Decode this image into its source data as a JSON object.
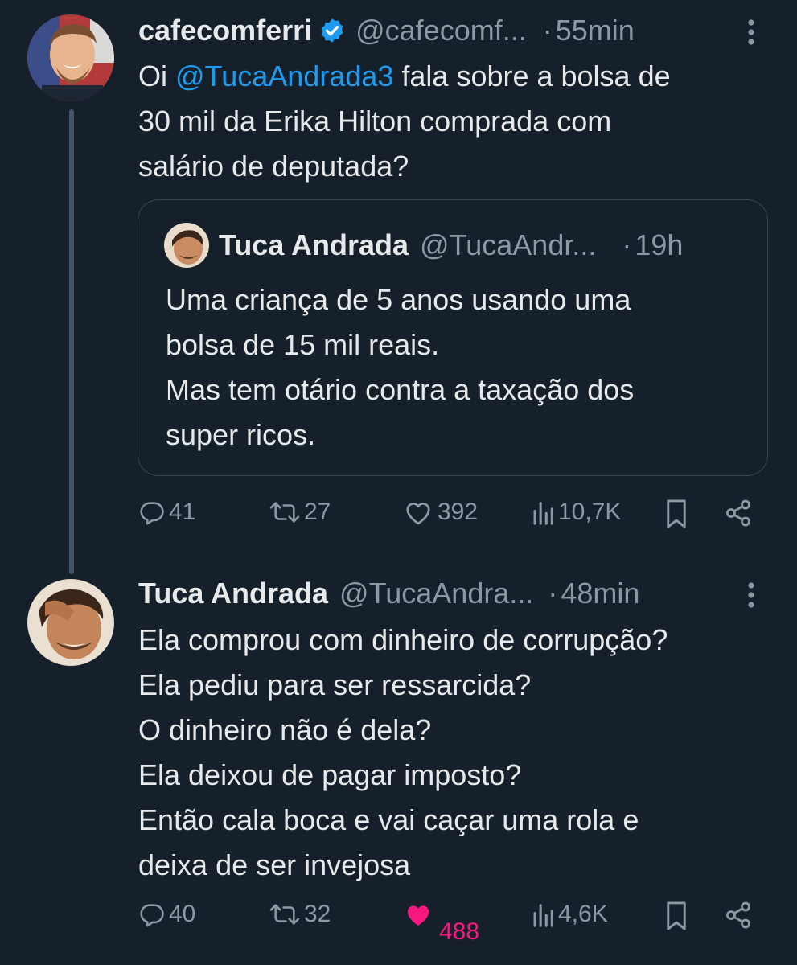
{
  "tweet1": {
    "author": {
      "name": "cafecomferri",
      "verified": true,
      "handle": "@cafecomf...",
      "separator": "·",
      "time": "55min"
    },
    "text_prefix": "Oi ",
    "mention": "@TucaAndrada3",
    "text_line1_suffix": " fala sobre a bolsa de",
    "text_line2": "30 mil da Erika Hilton comprada com",
    "text_line3": "salário de deputada?",
    "quote": {
      "author": {
        "name": "Tuca Andrada",
        "handle": "@TucaAndr...",
        "separator": "·",
        "time": "19h"
      },
      "lines": [
        "Uma criança  de 5 anos usando uma",
        "bolsa de 15 mil reais.",
        "Mas tem otário contra a taxação dos",
        "super ricos."
      ]
    },
    "stats": {
      "replies": "41",
      "retweets": "27",
      "likes": "392",
      "views": "10,7K",
      "liked": false
    }
  },
  "tweet2": {
    "author": {
      "name": "Tuca Andrada",
      "handle": "@TucaAndra...",
      "separator": "·",
      "time": "48min"
    },
    "lines": [
      "Ela comprou com dinheiro  de corrupção?",
      "Ela pediu para ser ressarcida?",
      "O dinheiro não é  dela?",
      "Ela deixou de pagar imposto?",
      "Então cala boca e vai caçar uma rola e",
      "deixa de ser invejosa"
    ],
    "stats": {
      "replies": "40",
      "retweets": "32",
      "likes": "488",
      "views": "4,6K",
      "liked": true
    }
  },
  "colors": {
    "background": "#15202b",
    "text": "#e7e9ea",
    "muted": "#8b98a5",
    "accent": "#1d9bf0",
    "like": "#f91880",
    "border": "#38444d"
  },
  "icons": [
    "verified-badge-icon",
    "more-icon",
    "reply-icon",
    "retweet-icon",
    "like-icon",
    "views-icon",
    "bookmark-icon",
    "share-icon"
  ]
}
